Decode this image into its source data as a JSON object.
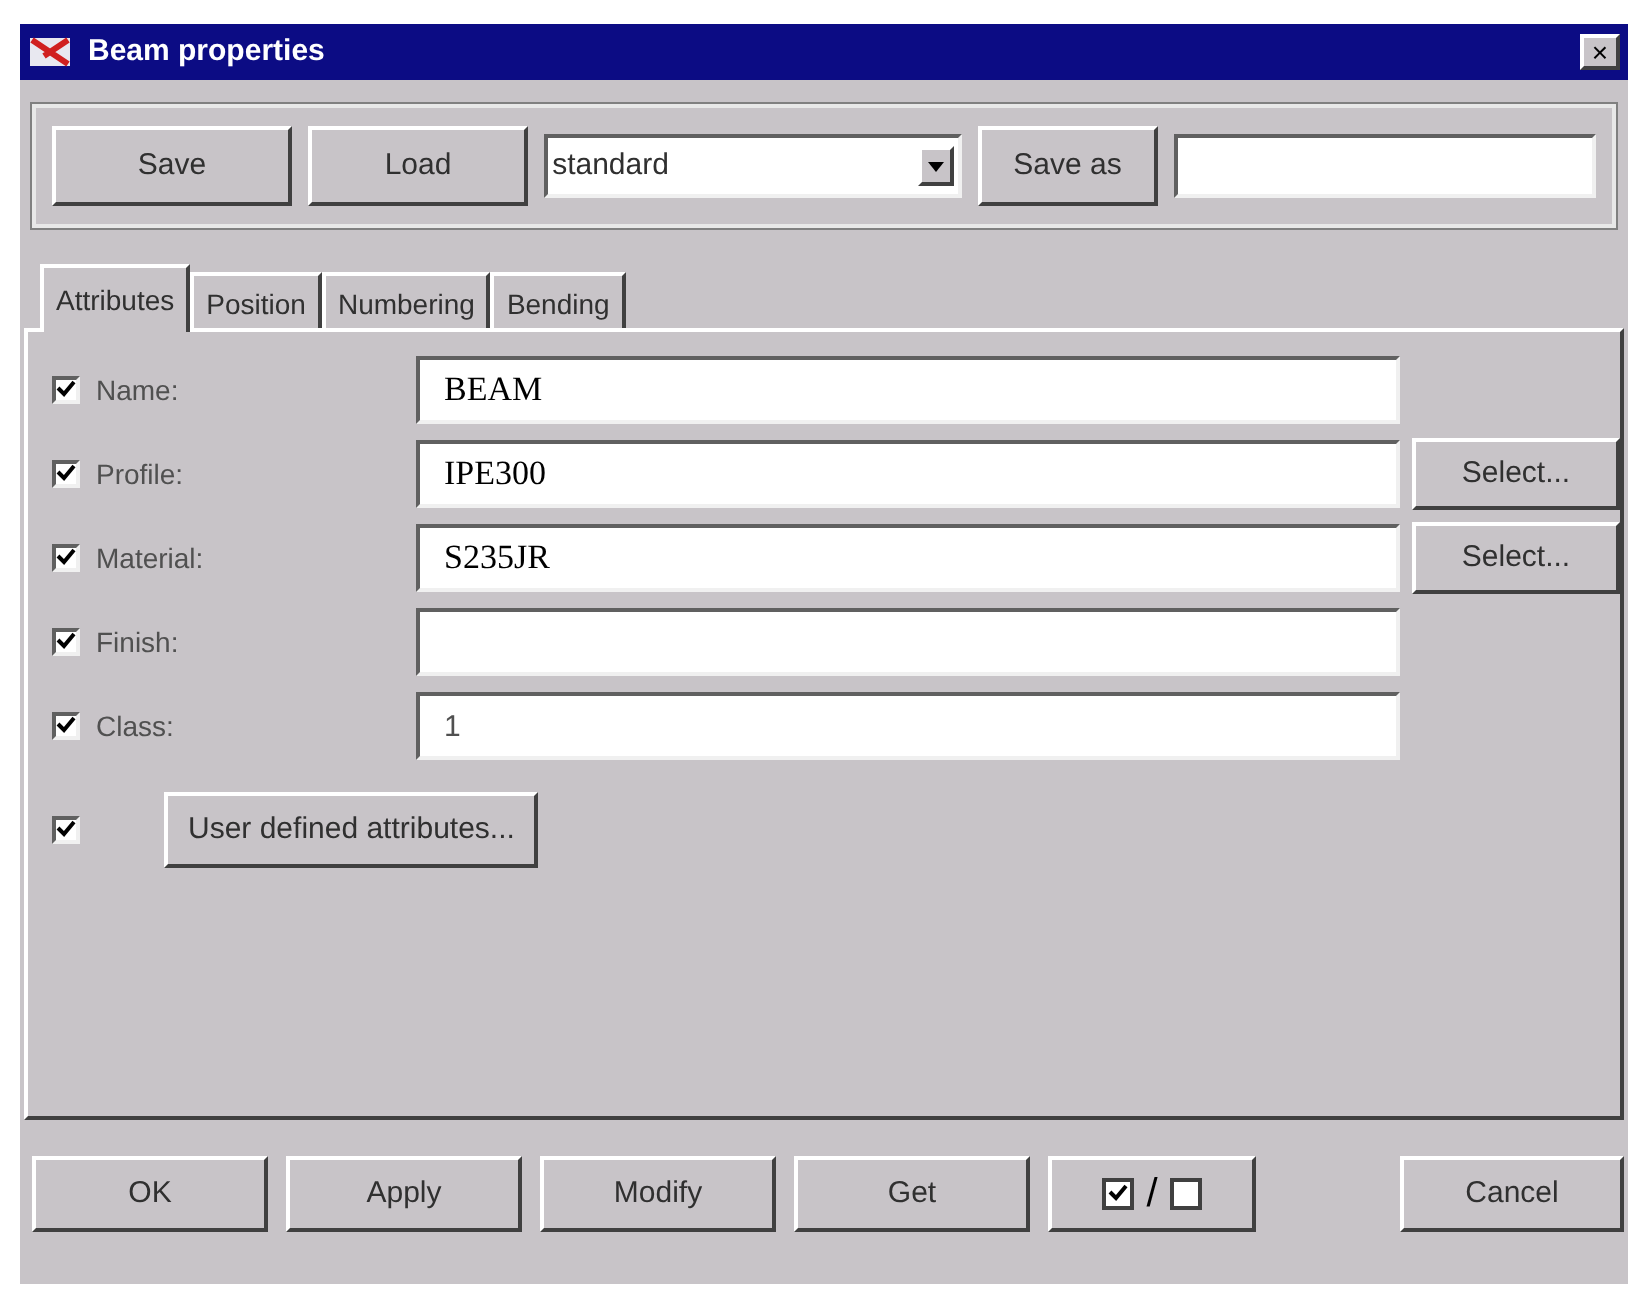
{
  "window": {
    "title": "Beam properties",
    "close": "×"
  },
  "toolbar": {
    "save": "Save",
    "load": "Load",
    "preset": {
      "value": "standard"
    },
    "save_as": "Save as"
  },
  "tabs": [
    {
      "label": "Attributes",
      "selected": true
    },
    {
      "label": "Position",
      "selected": false
    },
    {
      "label": "Numbering",
      "selected": false
    },
    {
      "label": "Bending",
      "selected": false
    }
  ],
  "fields": [
    {
      "label": "Name:",
      "checked": true,
      "value": "BEAM",
      "kind": "plain"
    },
    {
      "label": "Profile:",
      "checked": true,
      "value": "IPE300",
      "kind": "select",
      "button": "Select..."
    },
    {
      "label": "Material:",
      "checked": true,
      "value": "S235JR",
      "kind": "select",
      "button": "Select..."
    },
    {
      "label": "Finish:",
      "checked": true,
      "kind": "plain"
    },
    {
      "label": "Class:",
      "checked": true,
      "value": "1",
      "kind": "plain"
    }
  ],
  "user_defined": {
    "checked": true,
    "button": "User defined attributes..."
  },
  "footer": {
    "ok": "OK",
    "apply": "Apply",
    "modify": "Modify",
    "get": "Get",
    "toggle_separator": "/",
    "cancel": "Cancel"
  }
}
